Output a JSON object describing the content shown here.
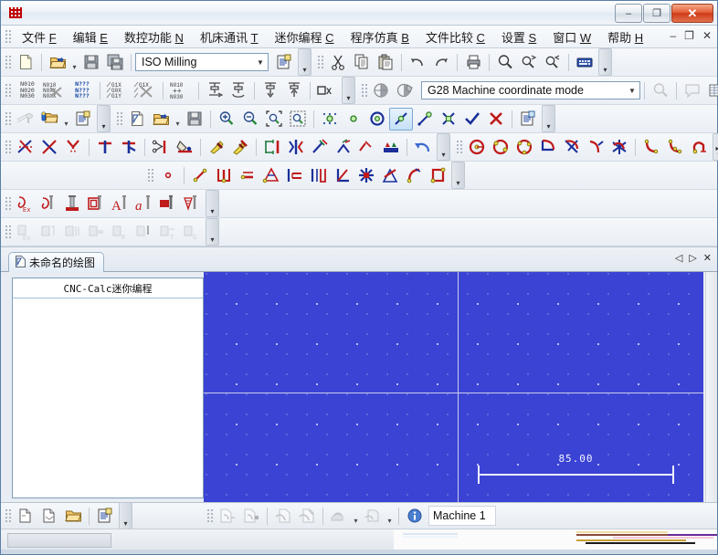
{
  "window": {
    "app_icon": "cimco-logo-icon",
    "minimize_label": "–",
    "maximize_label": "❐",
    "close_label": "✕"
  },
  "menubar": {
    "items": [
      {
        "text": "文件",
        "mnemonic": "F"
      },
      {
        "text": "编辑",
        "mnemonic": "E"
      },
      {
        "text": "数控功能",
        "mnemonic": "N"
      },
      {
        "text": "机床通讯",
        "mnemonic": "T"
      },
      {
        "text": "迷你编程",
        "mnemonic": "C"
      },
      {
        "text": "程序仿真",
        "mnemonic": "B"
      },
      {
        "text": "文件比较",
        "mnemonic": "C"
      },
      {
        "text": "设置",
        "mnemonic": "S"
      },
      {
        "text": "窗口",
        "mnemonic": "W"
      },
      {
        "text": "帮助",
        "mnemonic": "H"
      }
    ],
    "mdi_minimize": "–",
    "mdi_restore": "❐",
    "mdi_close": "✕"
  },
  "toolbar_standard": {
    "new_label": "new-file",
    "open_label": "open-file",
    "save_label": "save-file",
    "save_all_label": "save-all",
    "filetype_value": "ISO Milling",
    "filetype_options": [
      "ISO Milling"
    ],
    "setup_label": "file-setup",
    "cut_label": "cut",
    "copy_label": "copy",
    "paste_label": "paste",
    "undo_label": "undo",
    "redo_label": "redo",
    "print_label": "print",
    "find_label": "find",
    "find_next_label": "find-next",
    "find_prev_label": "find-previous",
    "keyboard_label": "keyboard"
  },
  "toolbar_nc": {
    "renumber_label": "N010 N020 N030",
    "remove_numbers_label": "N010 N0XX N0XX",
    "question_label": "N??? N??? N???",
    "g1x_label": "/G1X /G0X /G1Y",
    "g1x_remove_label": "/G1X /X",
    "plus_label": "N010 ++ N030",
    "tool_right_label": "tool-feed-right",
    "tool_rotate_label": "tool-rotate",
    "tool_down_label": "tool-down",
    "tool_up_label": "tool-up",
    "box_x_label": "□X",
    "machine_a_label": "machine-setup-a",
    "machine_b_label": "machine-setup-b",
    "coord_mode_value": "G28 Machine coordinate mode",
    "coord_mode_options": [
      "G28 Machine coordinate mode"
    ],
    "search_label": "search-backplot",
    "comment_label": "comment",
    "table_label": "table-view"
  },
  "toolbar_cnccalc": {
    "pin_label": "pin-tool",
    "open_lib_label": "open-library",
    "props_label": "properties",
    "new_draw_label": "new-drawing",
    "open_draw_label": "open-drawing",
    "save_draw_label": "save-drawing",
    "zoom_in_label": "zoom-in",
    "zoom_out_label": "zoom-out",
    "zoom_fit_label": "zoom-fit",
    "zoom_window_label": "zoom-window",
    "snap_grid_label": "snap-grid",
    "snap_point_label": "snap-point",
    "snap_circle_label": "snap-circle",
    "snap_line_label": "snap-line",
    "snap_endpoint_label": "snap-endpoint",
    "snap_intersect_label": "snap-intersection",
    "accept_label": "accept",
    "cancel_label": "cancel",
    "settings_label": "drawing-settings"
  },
  "toolbar_edit": {
    "trim_both_label": "trim-both",
    "trim_one_label": "trim-one",
    "trim_corner_label": "trim-corner",
    "divide_label": "divide",
    "divide_t_label": "divide-t",
    "cut_entity_label": "cut-entity",
    "fill_label": "fill-color",
    "erase_label": "erase",
    "erase_multi_label": "erase-multiple",
    "mirror_label": "mirror",
    "flip_label": "flip",
    "rotate_copy_label": "rotate-copy",
    "rotate_label": "rotate",
    "offset_label": "offset",
    "stack_label": "stack",
    "undo_draw_label": "undo-draw",
    "circle_center_label": "circle-center",
    "circle_2pt_label": "circle-2-point",
    "circle_3pt_label": "circle-3-point",
    "arc_corner_label": "arc-corner",
    "arc_cross_label": "arc-cross",
    "arc_tangent_label": "arc-tangent",
    "arc_star_label": "arc-star",
    "spline1_label": "spline-1",
    "spline2_label": "spline-2",
    "spline3_label": "spline-3"
  },
  "toolbar_geom": {
    "point_label": "point",
    "line_label": "line",
    "line_vert_label": "line-vertical",
    "line_horiz_label": "line-horizontal",
    "line_angle_label": "line-angle",
    "line_parallel_label": "line-parallel",
    "line_perp_label": "line-perpendicular",
    "angle_label": "angle",
    "polygon_label": "polygon",
    "tangent_label": "tangent",
    "fillet_label": "fillet",
    "rectangle_label": "rectangle"
  },
  "toolbar_text": {
    "dim_ex_label": "dimension-ex",
    "dim_label": "dimension",
    "anvil_label": "anvil",
    "engrave_label": "engrave",
    "text_a_label": "text-uppercase",
    "text_i_label": "text-italic",
    "text_block_label": "text-block",
    "text_pattern_label": "text-pattern"
  },
  "toolbar_disabled": {
    "b1_label": "shape-ex",
    "b2_label": "shape-2",
    "b3_label": "shape-3",
    "b4_label": "shape-4",
    "b5_label": "shape-r",
    "b6_label": "shape-6",
    "b7_label": "shape-t",
    "b8_label": "shape-g"
  },
  "document_tabs": {
    "tabs": [
      {
        "label": "未命名的绘图",
        "icon": "drawing-icon",
        "active": true
      }
    ],
    "nav_prev": "◁",
    "nav_next": "▷",
    "nav_close": "✕"
  },
  "left_panel": {
    "title": "CNC-Calc迷你编程"
  },
  "canvas": {
    "background_color": "#3b43d4",
    "dimension_label": "85.00"
  },
  "bottom_toolbar": {
    "new_prog_label": "new-program",
    "recv_prog_label": "receive-program",
    "open_folder_label": "open-folder",
    "setup_label": "setup",
    "dnc_send_label": "dnc-send",
    "dnc_recv_label": "dnc-receive",
    "transfer_label": "transfer",
    "transfer_edit_label": "transfer-edit",
    "machine_sel_label": "machine-select",
    "machine_list_label": "machine-list",
    "info_label": "info",
    "machine_value": "Machine 1"
  }
}
